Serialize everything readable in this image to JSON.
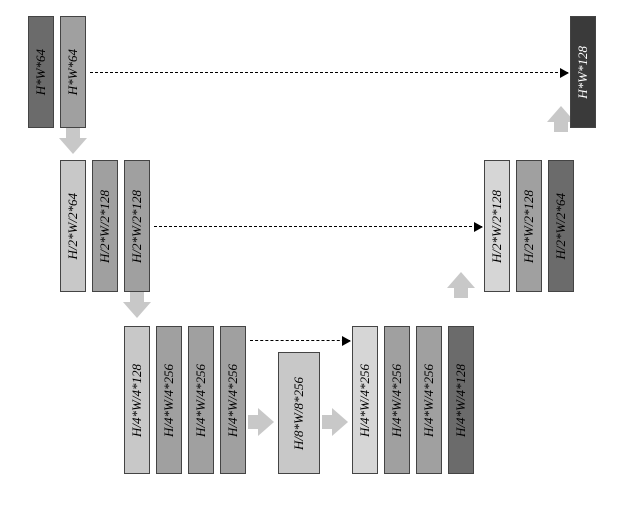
{
  "encoder": {
    "level0": [
      {
        "label": "H*W*64",
        "color": "c-dark1"
      },
      {
        "label": "H*W*64",
        "color": "c-med"
      }
    ],
    "level1": [
      {
        "label": "H/2*W/2*64",
        "color": "c-light"
      },
      {
        "label": "H/2*W/2*128",
        "color": "c-med"
      },
      {
        "label": "H/2*W/2*128",
        "color": "c-med"
      }
    ],
    "level2": [
      {
        "label": "H/4*W/4*128",
        "color": "c-light"
      },
      {
        "label": "H/4*W/4*256",
        "color": "c-med"
      },
      {
        "label": "H/4*W/4*256",
        "color": "c-med"
      },
      {
        "label": "H/4*W/4*256",
        "color": "c-med"
      }
    ],
    "bottleneck": {
      "label": "H/8*W/8*256",
      "color": "c-light"
    }
  },
  "decoder": {
    "level2": [
      {
        "label": "H/4*W/4*256",
        "color": "c-pale"
      },
      {
        "label": "H/4*W/4*256",
        "color": "c-med"
      },
      {
        "label": "H/4*W/4*256",
        "color": "c-med"
      },
      {
        "label": "H/4*W/4*128",
        "color": "c-dark1"
      }
    ],
    "level1": [
      {
        "label": "H/2*W/2*128",
        "color": "c-pale"
      },
      {
        "label": "H/2*W/2*128",
        "color": "c-med"
      },
      {
        "label": "H/2*W/2*64",
        "color": "c-dark1"
      }
    ],
    "level0": [
      {
        "label": "H*W*128",
        "color": "c-vdark"
      }
    ]
  }
}
